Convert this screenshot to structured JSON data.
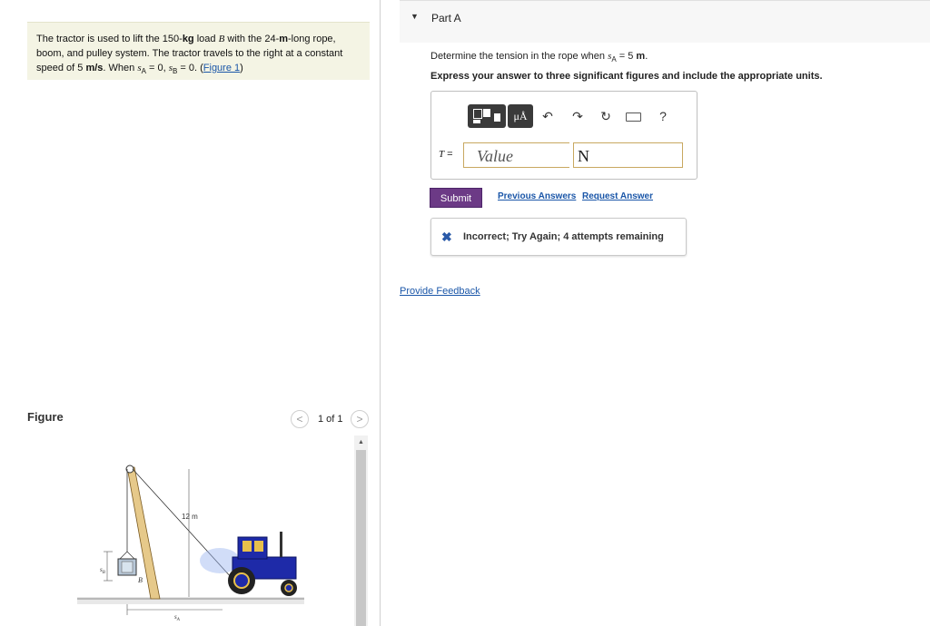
{
  "problem": {
    "text_1": "The tractor is used to lift the 150-",
    "unit_kg": "kg",
    "text_2": " load ",
    "var_B": "B",
    "text_3": " with the 24-",
    "unit_m": "m",
    "text_4": "-long rope, boom, and pulley system. The tractor travels to the right at a constant speed of 5 ",
    "unit_ms": "m/s",
    "text_5": ". When ",
    "sA_eq": "s",
    "sA_sub": "A",
    "text_6": " = 0, ",
    "sB_eq": "s",
    "sB_sub": "B",
    "text_7": " = 0. (",
    "figure_link": "Figure 1",
    "text_8": ")"
  },
  "figure": {
    "label": "Figure",
    "pager": "1 of 1",
    "prev_glyph": "<",
    "next_glyph": ">",
    "dim_12m": "12 m",
    "label_sB": "s",
    "label_sB_sub": "B",
    "label_B": "B",
    "label_sA": "s",
    "label_sA_sub": "A"
  },
  "part": {
    "arrow": "▼",
    "title": "Part A",
    "question_1a": "Determine the tension in the rope when ",
    "question_1_var": "s",
    "question_1_sub": "A",
    "question_1b": " = 5 ",
    "question_1_unit": "m",
    "question_1c": ".",
    "question_2": "Express your answer to three significant figures and include the appropriate units."
  },
  "answer": {
    "symbol_label": "T",
    "eq": " =",
    "value_placeholder": "Value",
    "units_value": "N",
    "units_tool": "μÅ",
    "undo_icon": "↶",
    "redo_icon": "↷",
    "reset_icon": "↻",
    "help_icon": "?"
  },
  "actions": {
    "submit": "Submit",
    "previous_answers": "Previous Answers",
    "request_answer": "Request Answer"
  },
  "feedback": {
    "icon": "✖",
    "message": "Incorrect; Try Again; 4 attempts remaining"
  },
  "provide_feedback": "Provide Feedback",
  "colors": {
    "submit_bg": "#6c3a86",
    "link": "#1a56a8",
    "problem_bg": "#f4f4e4",
    "tractor": "#1e2aa8"
  }
}
